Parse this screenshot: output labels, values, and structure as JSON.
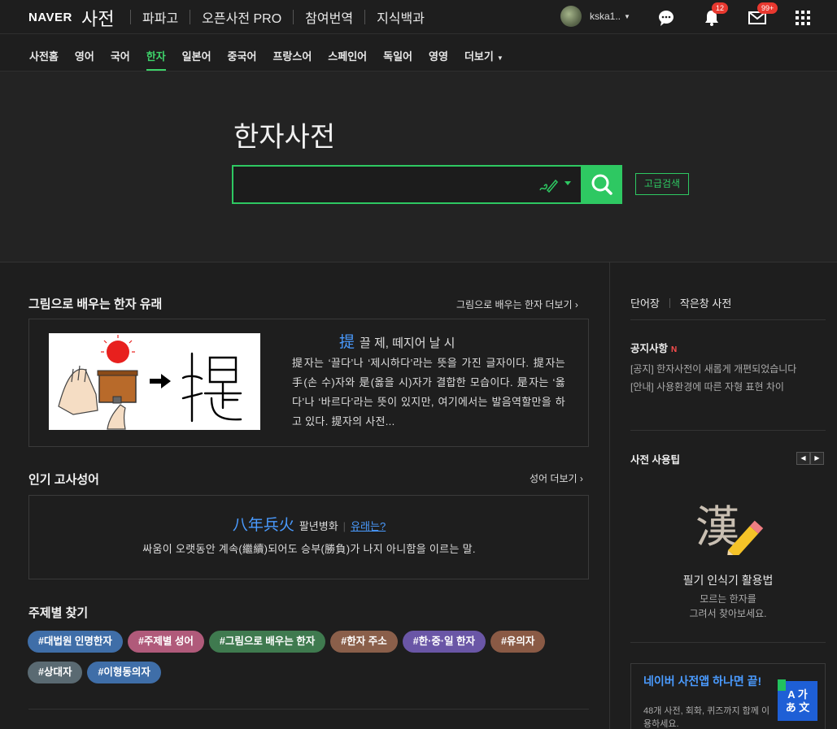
{
  "header": {
    "logo": "NAVER",
    "service": "사전",
    "nav": [
      "파파고",
      "오픈사전 PRO",
      "참여번역",
      "지식백과"
    ],
    "user": "kska1..",
    "notification_count": "12",
    "mail_count": "99+"
  },
  "categories": [
    "사전홈",
    "영어",
    "국어",
    "한자",
    "일본어",
    "중국어",
    "프랑스어",
    "스페인어",
    "독일어",
    "영영",
    "더보기"
  ],
  "search": {
    "title": "한자사전",
    "placeholder": "",
    "advanced_label": "고급검색"
  },
  "picture_section": {
    "title": "그림으로 배우는 한자 유래",
    "more": "그림으로 배우는 한자 더보기",
    "hanja": "提",
    "reading": "끌 제, 떼지어 날 시",
    "description": "提자는 ‘끌다’나 ‘제시하다’라는 뜻을 가진 글자이다. 提자는 手(손 수)자와 是(옳을 시)자가 결합한 모습이다. 是자는 ‘옳다’나 ‘바르다’라는 뜻이 있지만, 여기에서는 발음역할만을 하고 있다. 提자의 사전..."
  },
  "idiom_section": {
    "title": "인기 고사성어",
    "more": "성어 더보기",
    "hanja": "八年兵火",
    "reading": "팔년병화",
    "origin_link": "유래는?",
    "description": "싸움이 오랫동안 계속(繼續)되어도 승부(勝負)가 나지 아니함을 이르는 말."
  },
  "theme_section": {
    "title": "주제별 찾기",
    "tags": [
      {
        "label": "#대법원 인명한자",
        "color": "#3f6ea8"
      },
      {
        "label": "#주제별 성어",
        "color": "#b05a7a"
      },
      {
        "label": "#그림으로 배우는 한자",
        "color": "#3f7a4f"
      },
      {
        "label": "#한자 주소",
        "color": "#8a5f4a"
      },
      {
        "label": "#한·중·일 한자",
        "color": "#6a56a6"
      },
      {
        "label": "#유의자",
        "color": "#8a5a45"
      },
      {
        "label": "#상대자",
        "color": "#5a6a72"
      },
      {
        "label": "#이형동의자",
        "color": "#3f6ea8"
      }
    ]
  },
  "sidebar": {
    "links": [
      "단어장",
      "작은창 사전"
    ],
    "notice_title": "공지사항",
    "notice_new": "N",
    "notices": [
      "[공지] 한자사전이 새롭게 개편되었습니다",
      "[안내] 사용환경에 따른 자형 표현 차이"
    ],
    "tip_title": "사전 사용팁",
    "tip_hanja": "漢",
    "tip_name": "필기 인식기 활용법",
    "tip_desc_1": "모르는 한자를",
    "tip_desc_2": "그려서 찾아보세요.",
    "app_title": "네이버 사전앱 하나면 끝!",
    "app_desc": "48개 사전, 회화, 퀴즈까지 함께 이용하세요.",
    "app_icon_top": "A 가",
    "app_icon_bottom": "あ 文"
  },
  "colors": {
    "accent_green": "#2ec862",
    "link_blue": "#4a9bff",
    "badge_red": "#e8382f"
  }
}
